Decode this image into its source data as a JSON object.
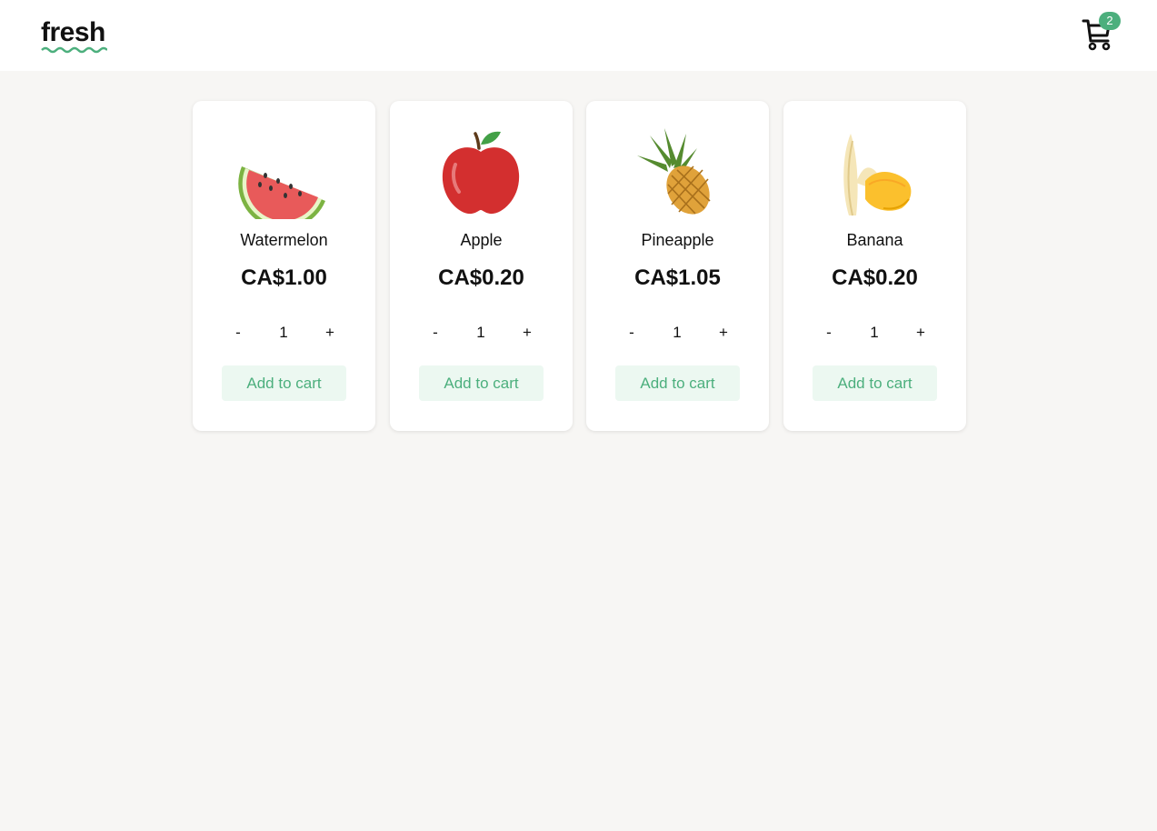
{
  "header": {
    "logo": "fresh",
    "cart": {
      "icon": "shopping-cart-icon",
      "count": "2",
      "badge_color": "#4caf7d"
    }
  },
  "products": [
    {
      "name": "Watermelon",
      "price": "CA$1.00",
      "quantity": "1",
      "icon": "watermelon-icon"
    },
    {
      "name": "Apple",
      "price": "CA$0.20",
      "quantity": "1",
      "icon": "apple-icon"
    },
    {
      "name": "Pineapple",
      "price": "CA$1.05",
      "quantity": "1",
      "icon": "pineapple-icon"
    },
    {
      "name": "Banana",
      "price": "CA$0.20",
      "quantity": "1",
      "icon": "banana-icon"
    }
  ],
  "labels": {
    "decrement": "-",
    "increment": "+",
    "add_to_cart": "Add to cart"
  },
  "colors": {
    "accent": "#4caf7d",
    "accent_bg": "#ecf8f1",
    "page_bg": "#f7f6f4"
  }
}
